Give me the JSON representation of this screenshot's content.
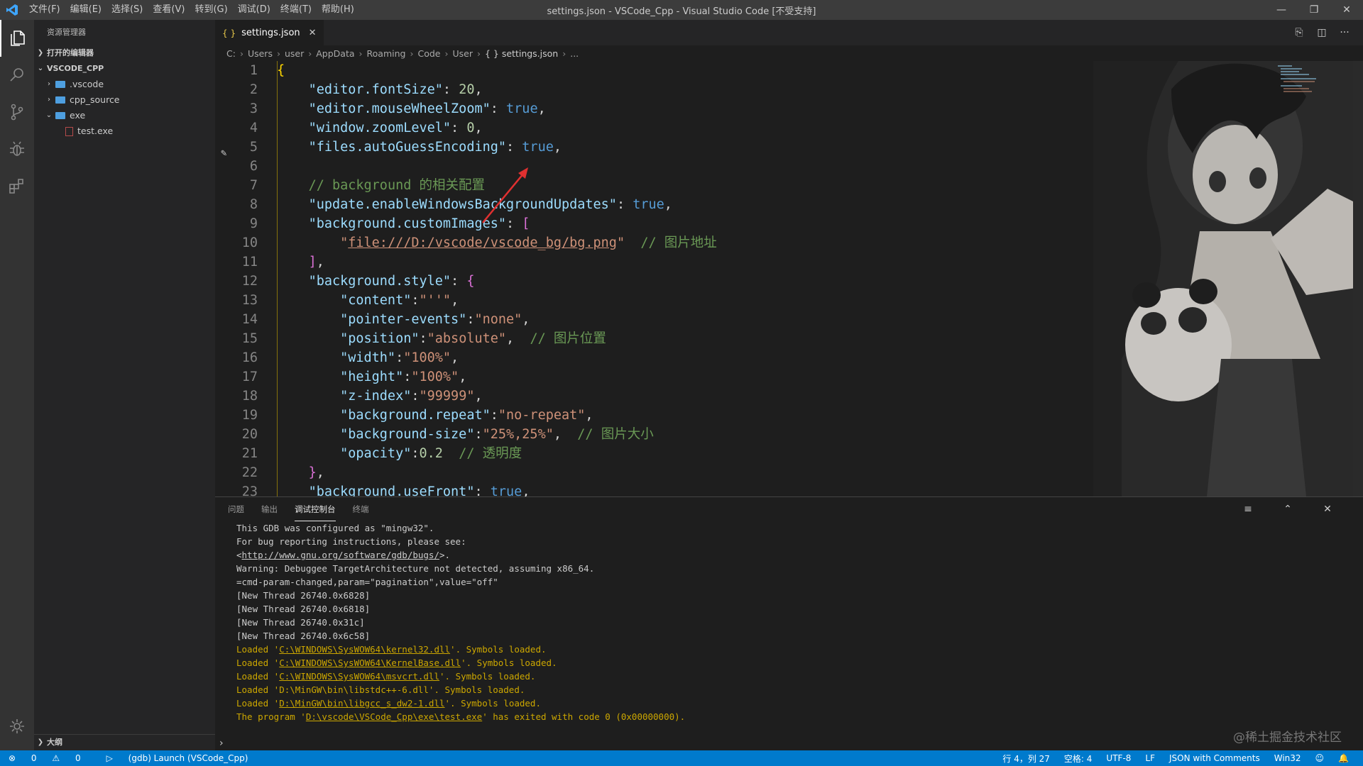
{
  "titlebar": {
    "menus": [
      "文件(F)",
      "编辑(E)",
      "选择(S)",
      "查看(V)",
      "转到(G)",
      "调试(D)",
      "终端(T)",
      "帮助(H)"
    ],
    "title": "settings.json - VSCode_Cpp - Visual Studio Code [不受支持]"
  },
  "sidebar": {
    "header": "资源管理器",
    "open_editors": "打开的编辑器",
    "workspace": "VSCODE_CPP",
    "tree": [
      {
        "label": ".vscode",
        "type": "folder",
        "depth": 1
      },
      {
        "label": "cpp_source",
        "type": "folder",
        "depth": 1
      },
      {
        "label": "exe",
        "type": "folder-open",
        "depth": 1
      },
      {
        "label": "test.exe",
        "type": "file",
        "depth": 2
      }
    ],
    "outline": "大纲"
  },
  "editor": {
    "tab": "settings.json",
    "breadcrumb": [
      "C:",
      "Users",
      "user",
      "AppData",
      "Roaming",
      "Code",
      "User",
      "{ } settings.json",
      "..."
    ],
    "lines": [
      {
        "n": "1",
        "t": [
          {
            "c": "br1",
            "v": "{"
          }
        ]
      },
      {
        "n": "2",
        "t": [
          {
            "c": "p",
            "v": "    "
          },
          {
            "c": "k",
            "v": "\"editor.fontSize\""
          },
          {
            "c": "p",
            "v": ": "
          },
          {
            "c": "n",
            "v": "20"
          },
          {
            "c": "p",
            "v": ","
          }
        ]
      },
      {
        "n": "3",
        "t": [
          {
            "c": "p",
            "v": "    "
          },
          {
            "c": "k",
            "v": "\"editor.mouseWheelZoom\""
          },
          {
            "c": "p",
            "v": ": "
          },
          {
            "c": "b",
            "v": "true"
          },
          {
            "c": "p",
            "v": ","
          }
        ]
      },
      {
        "n": "4",
        "t": [
          {
            "c": "p",
            "v": "    "
          },
          {
            "c": "k",
            "v": "\"window.zoomLevel\""
          },
          {
            "c": "p",
            "v": ": "
          },
          {
            "c": "n",
            "v": "0"
          },
          {
            "c": "p",
            "v": ","
          }
        ]
      },
      {
        "n": "5",
        "t": [
          {
            "c": "p",
            "v": "    "
          },
          {
            "c": "k",
            "v": "\"files.autoGuessEncoding\""
          },
          {
            "c": "p",
            "v": ": "
          },
          {
            "c": "b",
            "v": "true"
          },
          {
            "c": "p",
            "v": ","
          }
        ]
      },
      {
        "n": "6",
        "t": []
      },
      {
        "n": "7",
        "t": [
          {
            "c": "p",
            "v": "    "
          },
          {
            "c": "c",
            "v": "// background 的相关配置"
          }
        ]
      },
      {
        "n": "8",
        "t": [
          {
            "c": "p",
            "v": "    "
          },
          {
            "c": "k",
            "v": "\"update.enableWindowsBackgroundUpdates\""
          },
          {
            "c": "p",
            "v": ": "
          },
          {
            "c": "b",
            "v": "true"
          },
          {
            "c": "p",
            "v": ","
          }
        ]
      },
      {
        "n": "9",
        "t": [
          {
            "c": "p",
            "v": "    "
          },
          {
            "c": "k",
            "v": "\"background.customImages\""
          },
          {
            "c": "p",
            "v": ": "
          },
          {
            "c": "br2",
            "v": "["
          }
        ]
      },
      {
        "n": "10",
        "t": [
          {
            "c": "p",
            "v": "        "
          },
          {
            "c": "s",
            "v": "\""
          },
          {
            "c": "s u",
            "v": "file:///D:/vscode/vscode_bg/bg.png"
          },
          {
            "c": "s",
            "v": "\""
          },
          {
            "c": "p",
            "v": "  "
          },
          {
            "c": "c",
            "v": "// 图片地址"
          }
        ]
      },
      {
        "n": "11",
        "t": [
          {
            "c": "p",
            "v": "    "
          },
          {
            "c": "br2",
            "v": "]"
          },
          {
            "c": "p",
            "v": ","
          }
        ]
      },
      {
        "n": "12",
        "t": [
          {
            "c": "p",
            "v": "    "
          },
          {
            "c": "k",
            "v": "\"background.style\""
          },
          {
            "c": "p",
            "v": ": "
          },
          {
            "c": "br2",
            "v": "{"
          }
        ]
      },
      {
        "n": "13",
        "t": [
          {
            "c": "p",
            "v": "        "
          },
          {
            "c": "k",
            "v": "\"content\""
          },
          {
            "c": "p",
            "v": ":"
          },
          {
            "c": "s",
            "v": "\"''\""
          },
          {
            "c": "p",
            "v": ","
          }
        ]
      },
      {
        "n": "14",
        "t": [
          {
            "c": "p",
            "v": "        "
          },
          {
            "c": "k",
            "v": "\"pointer-events\""
          },
          {
            "c": "p",
            "v": ":"
          },
          {
            "c": "s",
            "v": "\"none\""
          },
          {
            "c": "p",
            "v": ","
          }
        ]
      },
      {
        "n": "15",
        "t": [
          {
            "c": "p",
            "v": "        "
          },
          {
            "c": "k",
            "v": "\"position\""
          },
          {
            "c": "p",
            "v": ":"
          },
          {
            "c": "s",
            "v": "\"absolute\""
          },
          {
            "c": "p",
            "v": ",  "
          },
          {
            "c": "c",
            "v": "// 图片位置"
          }
        ]
      },
      {
        "n": "16",
        "t": [
          {
            "c": "p",
            "v": "        "
          },
          {
            "c": "k",
            "v": "\"width\""
          },
          {
            "c": "p",
            "v": ":"
          },
          {
            "c": "s",
            "v": "\"100%\""
          },
          {
            "c": "p",
            "v": ","
          }
        ]
      },
      {
        "n": "17",
        "t": [
          {
            "c": "p",
            "v": "        "
          },
          {
            "c": "k",
            "v": "\"height\""
          },
          {
            "c": "p",
            "v": ":"
          },
          {
            "c": "s",
            "v": "\"100%\""
          },
          {
            "c": "p",
            "v": ","
          }
        ]
      },
      {
        "n": "18",
        "t": [
          {
            "c": "p",
            "v": "        "
          },
          {
            "c": "k",
            "v": "\"z-index\""
          },
          {
            "c": "p",
            "v": ":"
          },
          {
            "c": "s",
            "v": "\"99999\""
          },
          {
            "c": "p",
            "v": ","
          }
        ]
      },
      {
        "n": "19",
        "t": [
          {
            "c": "p",
            "v": "        "
          },
          {
            "c": "k",
            "v": "\"background.repeat\""
          },
          {
            "c": "p",
            "v": ":"
          },
          {
            "c": "s",
            "v": "\"no-repeat\""
          },
          {
            "c": "p",
            "v": ","
          }
        ]
      },
      {
        "n": "20",
        "t": [
          {
            "c": "p",
            "v": "        "
          },
          {
            "c": "k",
            "v": "\"background-size\""
          },
          {
            "c": "p",
            "v": ":"
          },
          {
            "c": "s",
            "v": "\"25%,25%\""
          },
          {
            "c": "p",
            "v": ",  "
          },
          {
            "c": "c",
            "v": "// 图片大小"
          }
        ]
      },
      {
        "n": "21",
        "t": [
          {
            "c": "p",
            "v": "        "
          },
          {
            "c": "k",
            "v": "\"opacity\""
          },
          {
            "c": "p",
            "v": ":"
          },
          {
            "c": "n",
            "v": "0.2"
          },
          {
            "c": "p",
            "v": "  "
          },
          {
            "c": "c",
            "v": "// 透明度"
          }
        ]
      },
      {
        "n": "22",
        "t": [
          {
            "c": "p",
            "v": "    "
          },
          {
            "c": "br2",
            "v": "}"
          },
          {
            "c": "p",
            "v": ","
          }
        ]
      },
      {
        "n": "23",
        "t": [
          {
            "c": "p",
            "v": "    "
          },
          {
            "c": "k",
            "v": "\"background.useFront\""
          },
          {
            "c": "p",
            "v": ": "
          },
          {
            "c": "b",
            "v": "true"
          },
          {
            "c": "p",
            "v": ","
          }
        ]
      }
    ]
  },
  "panel": {
    "tabs": [
      "问题",
      "输出",
      "调试控制台",
      "终端"
    ],
    "active_tab": "调试控制台",
    "console": [
      {
        "t": [
          {
            "v": "This GDB was configured as \"mingw32\"."
          }
        ]
      },
      {
        "t": [
          {
            "v": "For bug reporting instructions, please see:"
          }
        ]
      },
      {
        "t": [
          {
            "v": "<"
          },
          {
            "v": "http://www.gnu.org/software/gdb/bugs/",
            "link": true
          },
          {
            "v": ">."
          }
        ]
      },
      {
        "t": [
          {
            "v": "Warning: Debuggee TargetArchitecture not detected, assuming x86_64."
          }
        ]
      },
      {
        "t": [
          {
            "v": "=cmd-param-changed,param=\"pagination\",value=\"off\""
          }
        ]
      },
      {
        "t": [
          {
            "v": "[New Thread 26740.0x6828]"
          }
        ]
      },
      {
        "t": [
          {
            "v": "[New Thread 26740.0x6818]"
          }
        ]
      },
      {
        "t": [
          {
            "v": "[New Thread 26740.0x31c]"
          }
        ]
      },
      {
        "t": [
          {
            "v": "[New Thread 26740.0x6c58]"
          }
        ]
      },
      {
        "warn": true,
        "t": [
          {
            "v": "Loaded '"
          },
          {
            "v": "C:\\WINDOWS\\SysWOW64\\kernel32.dll",
            "link": true
          },
          {
            "v": "'. Symbols loaded."
          }
        ]
      },
      {
        "warn": true,
        "t": [
          {
            "v": "Loaded '"
          },
          {
            "v": "C:\\WINDOWS\\SysWOW64\\KernelBase.dll",
            "link": true
          },
          {
            "v": "'. Symbols loaded."
          }
        ]
      },
      {
        "warn": true,
        "t": [
          {
            "v": "Loaded '"
          },
          {
            "v": "C:\\WINDOWS\\SysWOW64\\msvcrt.dll",
            "link": true
          },
          {
            "v": "'. Symbols loaded."
          }
        ]
      },
      {
        "warn": true,
        "t": [
          {
            "v": "Loaded 'D:\\MinGW\\bin\\libstdc++-6.dll'. Symbols loaded."
          }
        ]
      },
      {
        "warn": true,
        "t": [
          {
            "v": "Loaded '"
          },
          {
            "v": "D:\\MinGW\\bin\\libgcc_s_dw2-1.dll",
            "link": true
          },
          {
            "v": "'. Symbols loaded."
          }
        ]
      },
      {
        "warn": true,
        "t": [
          {
            "v": "The program '"
          },
          {
            "v": "D:\\vscode\\VSCode_Cpp\\exe\\test.exe",
            "link": true
          },
          {
            "v": "' has exited with code 0 (0x00000000)."
          }
        ]
      }
    ],
    "prompt": "›",
    "watermark": "@稀土掘金技术社区"
  },
  "statusbar": {
    "errors": "0",
    "warnings": "0",
    "debug": "(gdb) Launch (VSCode_Cpp)",
    "position": "行 4，列 27",
    "spaces": "空格: 4",
    "encoding": "UTF-8",
    "eol": "LF",
    "language": "JSON with Comments",
    "platform": "Win32"
  },
  "colors": {
    "accent": "#007acc",
    "titlebar": "#3c3c3c",
    "sidebar": "#252526",
    "editor": "#1e1e1e"
  }
}
